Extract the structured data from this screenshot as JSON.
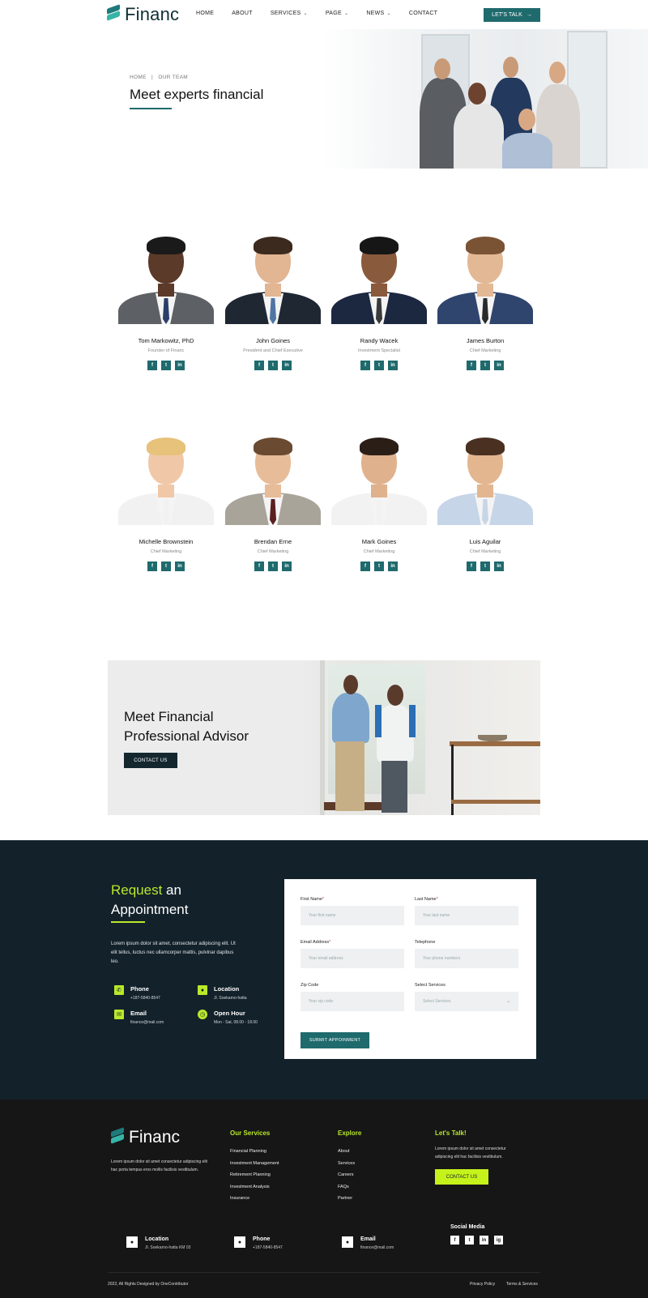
{
  "brand": {
    "name": "Financ",
    "accent": "#1f6a6d",
    "lime": "#b8e92b",
    "dark": "#13212a"
  },
  "header": {
    "nav": [
      {
        "label": "HOME",
        "dropdown": false
      },
      {
        "label": "ABOUT",
        "dropdown": false
      },
      {
        "label": "SERVICES",
        "dropdown": true
      },
      {
        "label": "PAGE",
        "dropdown": true
      },
      {
        "label": "NEWS",
        "dropdown": true
      },
      {
        "label": "CONTACT",
        "dropdown": false
      }
    ],
    "cta": "LET'S TALK",
    "cta_icon": "arrow-right-icon"
  },
  "hero": {
    "breadcrumb": {
      "home": "HOME",
      "separator": "|",
      "current": "OUR TEAM"
    },
    "title": "Meet experts financial"
  },
  "team": [
    {
      "name": "Tom Markowitz, PhD",
      "role": "Founder of Financ"
    },
    {
      "name": "John Goines",
      "role": "President and Chief Executive"
    },
    {
      "name": "Randy Wacek",
      "role": "Investment Specialist"
    },
    {
      "name": "James Burton",
      "role": "Chief Marketing"
    },
    {
      "name": "Michelle Brownstein",
      "role": "Chief Marketing"
    },
    {
      "name": "Brendan Erne",
      "role": "Chief Marketing"
    },
    {
      "name": "Mark Goines",
      "role": "Chief Marketing"
    },
    {
      "name": "Luis Aguilar",
      "role": "Chief Marketing"
    }
  ],
  "member_socials": [
    "f",
    "t",
    "in"
  ],
  "banner": {
    "title_line1": "Meet Financial",
    "title_line2": "Professional Advisor",
    "button": "CONTACT US"
  },
  "appointment": {
    "title_highlight": "Request",
    "title_rest": " an",
    "title_line2": "Appointment",
    "text": "Lorem ipsum dolor sit amet, consectetur adipiscing elit. Ut elit tellus, luctus nec ullamcorper mattis, pulvinar dapibus leo.",
    "info": [
      {
        "label": "Phone",
        "value": "+187-5840-8547",
        "icon": "phone-icon"
      },
      {
        "label": "Location",
        "value": "Jl. Soekarno-hatta",
        "icon": "location-pin-icon"
      },
      {
        "label": "Email",
        "value": "finance@mail.com",
        "icon": "email-icon"
      },
      {
        "label": "Open Hour",
        "value": "Mon - Sat, 08.00 - 18.00",
        "icon": "clock-icon"
      }
    ],
    "form": {
      "first_name": {
        "label": "First Name",
        "placeholder": "Your first name",
        "required": true
      },
      "last_name": {
        "label": "Last Name",
        "placeholder": "Your last name",
        "required": true
      },
      "email": {
        "label": "Email Address",
        "placeholder": "Your email address",
        "required": true
      },
      "telephone": {
        "label": "Telephone",
        "placeholder": "Your phone numbers",
        "required": false
      },
      "zip": {
        "label": "Zip Code",
        "placeholder": "Your zip code",
        "required": false
      },
      "services": {
        "label": "Select Services",
        "value": "Select Services",
        "required": false
      },
      "required_mark": "*",
      "submit": "SUBMIT APPOINMENT"
    }
  },
  "footer": {
    "desc": "Lorem ipsum dolor sit amet consectetur adipiscing elit hac porta tempus eros mollis facilisis vestibulum.",
    "services_title": "Our Services",
    "services": [
      "Financial Planning",
      "Investment Management",
      "Retirement Planning",
      "Investment Analysis",
      "Insurance"
    ],
    "explore_title": "Explore",
    "explore": [
      "About",
      "Services",
      "Careers",
      "FAQs",
      "Partner"
    ],
    "talk_title": "Let's Talk!",
    "talk_text": "Lorem ipsum dolor sit amet consectetur adipiscing elit hac facilisis vestibulum.",
    "talk_button": "CONTACT US",
    "contacts": [
      {
        "label": "Location",
        "value": "Jl. Soekarno-hatta KM 03",
        "icon": "location-pin-icon"
      },
      {
        "label": "Phone",
        "value": "+187-5840-8547",
        "icon": "phone-icon"
      },
      {
        "label": "Email",
        "value": "finance@mail.com",
        "icon": "email-icon"
      }
    ],
    "social_title": "Social Media",
    "social": [
      "f",
      "t",
      "in",
      "ig"
    ],
    "copyright": "2022, All Rights Designed by OneContributor",
    "privacy": "Privacy Policy",
    "terms": "Terms & Services"
  }
}
